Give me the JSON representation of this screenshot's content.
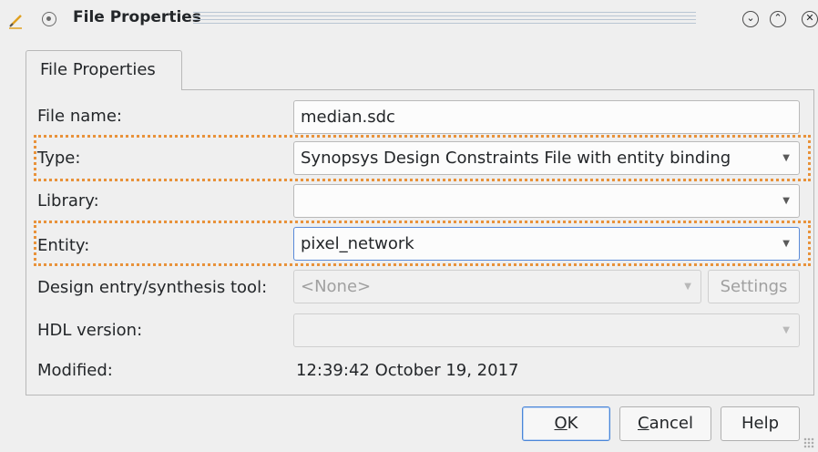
{
  "window": {
    "title": "File Properties"
  },
  "tab": {
    "label": "File Properties"
  },
  "form": {
    "file_name_label": "File name:",
    "file_name_value": "median.sdc",
    "type_label": "Type:",
    "type_value": "Synopsys Design Constraints File with entity binding",
    "library_label": "Library:",
    "library_value": "",
    "entity_label": "Entity:",
    "entity_value": "pixel_network",
    "tool_label": "Design entry/synthesis tool:",
    "tool_value": "<None>",
    "settings_label": "Settings",
    "hdl_label": "HDL version:",
    "hdl_value": "",
    "modified_label": "Modified:",
    "modified_value": "12:39:42 October 19, 2017"
  },
  "buttons": {
    "ok_accel": "O",
    "ok_rest": "K",
    "cancel_accel": "C",
    "cancel_rest": "ancel",
    "help": "Help"
  },
  "colors": {
    "highlight": "#e8923a",
    "focus": "#5a8ad8"
  },
  "icons": {
    "title_left": "pencil-icon",
    "menu": "window-menu-icon",
    "minimize": "minimize-icon",
    "maximize": "maximize-icon",
    "close": "close-icon",
    "dropdown": "chevron-down-icon"
  }
}
